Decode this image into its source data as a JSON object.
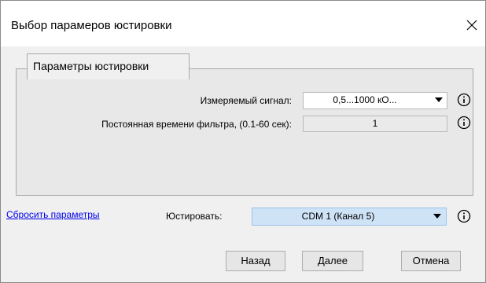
{
  "window": {
    "title": "Выбор парамеров юстировки"
  },
  "group": {
    "title": "Параметры юстировки",
    "signal_label": "Измеряемый сигнал:",
    "signal_value": "0,5...1000 кО...",
    "filter_label": "Постоянная времени фильтра, (0.1-60 сек):",
    "filter_value": "1"
  },
  "footer": {
    "reset_link": "Сбросить параметры",
    "adjust_label": "Юстировать:",
    "adjust_value": "CDM 1 (Канал 5)"
  },
  "buttons": {
    "back": "Назад",
    "next": "Далее",
    "cancel": "Отмена"
  },
  "icons": {
    "info": "info-icon",
    "close": "close-icon",
    "dropdown": "chevron-down-icon"
  }
}
